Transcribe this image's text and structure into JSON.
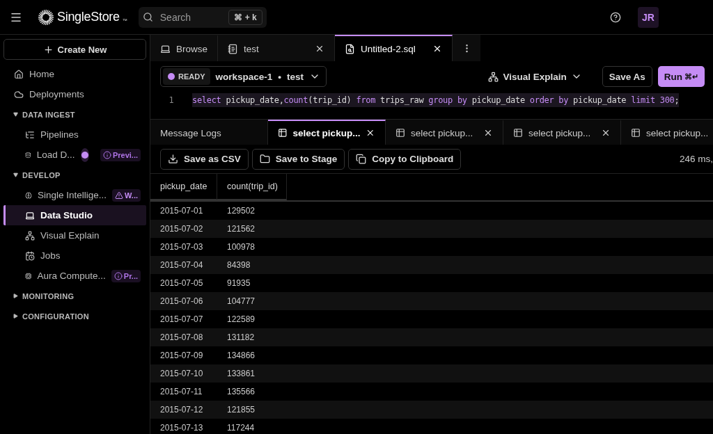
{
  "header": {
    "brand": "SingleStore",
    "trademark": "™",
    "search": {
      "placeholder": "Search",
      "shortcut": "⌘ + k"
    },
    "avatar": "JR"
  },
  "sidebar": {
    "create_button": "Create New",
    "items": [
      {
        "kind": "item",
        "label": "Home",
        "selected": false
      },
      {
        "kind": "item",
        "label": "Deployments",
        "selected": false
      },
      {
        "kind": "section",
        "label": "DATA INGEST",
        "expanded": true,
        "children": [
          {
            "kind": "item",
            "label": "Pipelines",
            "selected": false
          },
          {
            "kind": "item",
            "label": "Load D...",
            "selected": false,
            "dot": true,
            "badge": {
              "kind": "info",
              "text": "Previ..."
            }
          }
        ]
      },
      {
        "kind": "section",
        "label": "DEVELOP",
        "expanded": true,
        "children": [
          {
            "kind": "item",
            "label": "Single Intellige...",
            "selected": false,
            "badge": {
              "kind": "warning",
              "text": "W..."
            }
          },
          {
            "kind": "item",
            "label": "Data Studio",
            "selected": true
          },
          {
            "kind": "item",
            "label": "Visual Explain",
            "selected": false
          },
          {
            "kind": "item",
            "label": "Jobs",
            "selected": false
          },
          {
            "kind": "item",
            "label": "Aura Compute...",
            "selected": false,
            "badge": {
              "kind": "info",
              "text": "Pr..."
            }
          }
        ]
      },
      {
        "kind": "section",
        "label": "MONITORING",
        "expanded": false
      },
      {
        "kind": "section",
        "label": "CONFIGURATION",
        "expanded": false
      }
    ]
  },
  "file_tabs": [
    {
      "label": "Browse",
      "selected": false,
      "closable": false
    },
    {
      "label": "test",
      "selected": false,
      "closable": true
    },
    {
      "label": "Untitled-2.sql",
      "selected": true,
      "closable": true
    }
  ],
  "toolbar": {
    "status": "READY",
    "workspace": "workspace-1",
    "database": "test",
    "separator": "•",
    "visual_explain": "Visual Explain",
    "save_as": "Save As",
    "run": "Run",
    "run_shortcut": "⌘↵"
  },
  "editor": {
    "lines": [
      {
        "number": "1",
        "tokens": [
          {
            "kind": "keyword",
            "text": "select"
          },
          {
            "kind": "plain",
            "text": " pickup_date,"
          },
          {
            "kind": "keyword",
            "text": "count"
          },
          {
            "kind": "plain",
            "text": "(trip_id) "
          },
          {
            "kind": "keyword",
            "text": "from"
          },
          {
            "kind": "plain",
            "text": " trips_raw "
          },
          {
            "kind": "keyword",
            "text": "group by"
          },
          {
            "kind": "plain",
            "text": " pickup_date "
          },
          {
            "kind": "keyword",
            "text": "order by"
          },
          {
            "kind": "plain",
            "text": " pickup_date "
          },
          {
            "kind": "keyword",
            "text": "limit"
          },
          {
            "kind": "number",
            "text": " 300"
          },
          {
            "kind": "plain",
            "text": ";"
          }
        ]
      }
    ]
  },
  "result_tabs": [
    {
      "kind": "logs",
      "label": "Message Logs",
      "selected": false,
      "closable": false
    },
    {
      "kind": "result",
      "label": "select pickup...",
      "selected": true,
      "closable": true
    },
    {
      "kind": "result",
      "label": "select pickup...",
      "selected": false,
      "closable": true
    },
    {
      "kind": "result",
      "label": "select pickup...",
      "selected": false,
      "closable": true
    },
    {
      "kind": "result",
      "label": "select pickup...",
      "selected": false,
      "closable": false
    }
  ],
  "result_actions": [
    "Save as CSV",
    "Save to Stage",
    "Copy to Clipboard"
  ],
  "timing": "246 ms,",
  "table": {
    "columns": [
      "pickup_date",
      "count(trip_id)"
    ],
    "rows": [
      [
        "2015-07-01",
        "129502"
      ],
      [
        "2015-07-02",
        "121562"
      ],
      [
        "2015-07-03",
        "100978"
      ],
      [
        "2015-07-04",
        "84398"
      ],
      [
        "2015-07-05",
        "91935"
      ],
      [
        "2015-07-06",
        "104777"
      ],
      [
        "2015-07-07",
        "122589"
      ],
      [
        "2015-07-08",
        "131182"
      ],
      [
        "2015-07-09",
        "134866"
      ],
      [
        "2015-07-10",
        "133861"
      ],
      [
        "2015-07-11",
        "135566"
      ],
      [
        "2015-07-12",
        "121855"
      ],
      [
        "2015-07-13",
        "117244"
      ]
    ]
  }
}
